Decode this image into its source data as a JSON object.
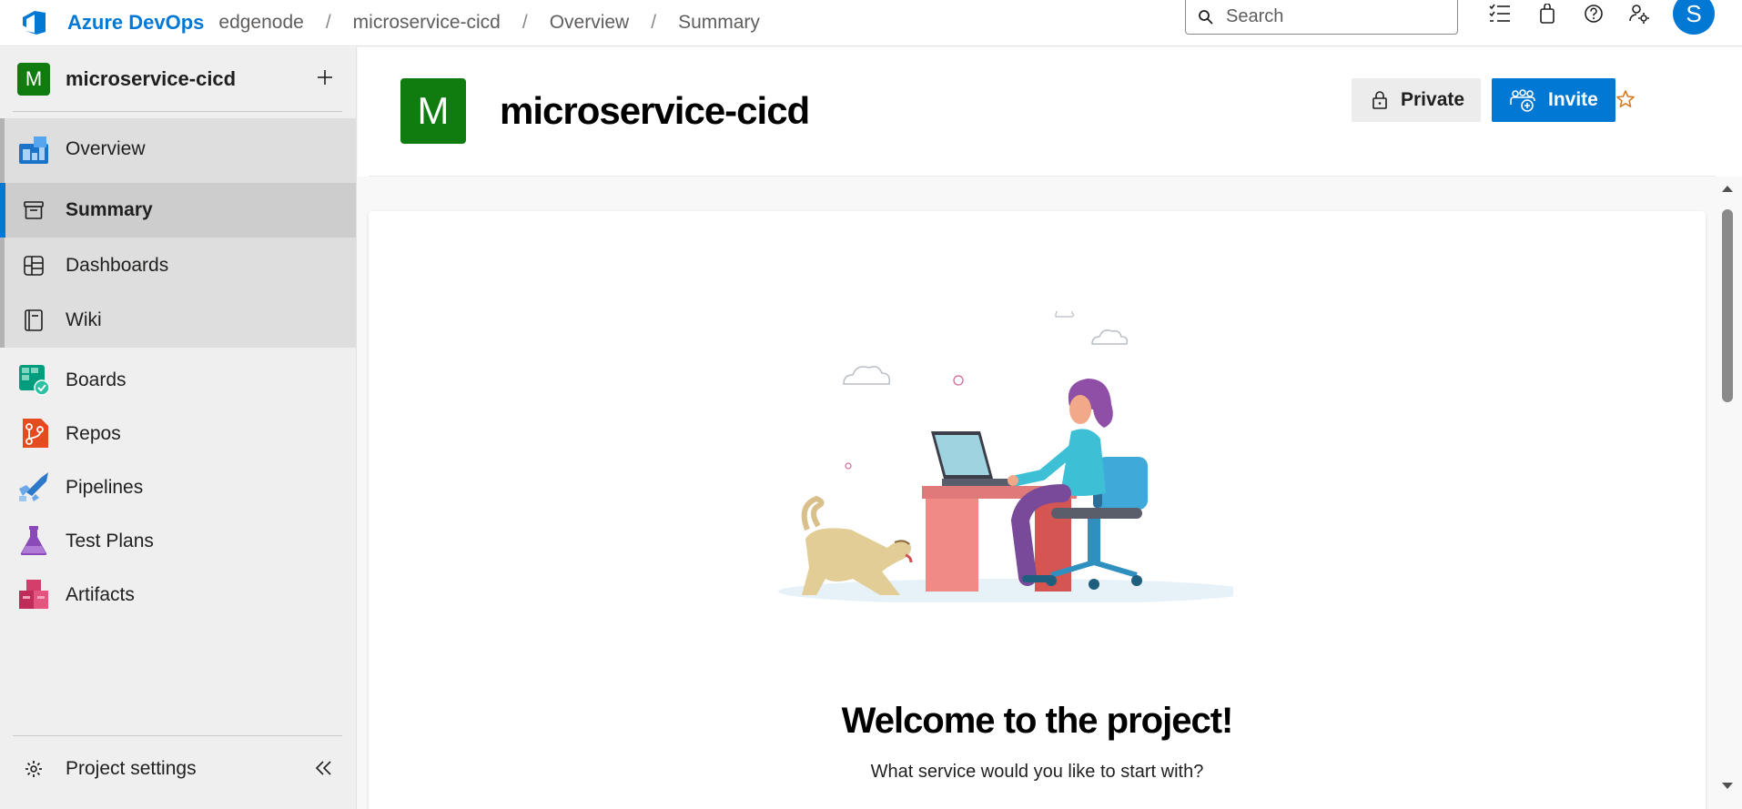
{
  "topbar": {
    "brand": "Azure DevOps",
    "breadcrumb": [
      "edgenode",
      "microservice-cicd",
      "Overview",
      "Summary"
    ],
    "separator": "/",
    "search_placeholder": "Search",
    "avatar_initial": "S",
    "icons": [
      "task-list-icon",
      "shopping-bag-icon",
      "help-icon",
      "user-settings-icon"
    ]
  },
  "sidebar": {
    "project_initial": "M",
    "project_name": "microservice-cicd",
    "items": [
      {
        "label": "Overview",
        "icon": "overview-icon"
      },
      {
        "label": "Summary",
        "icon": "summary-icon"
      },
      {
        "label": "Dashboards",
        "icon": "dashboards-icon"
      },
      {
        "label": "Wiki",
        "icon": "wiki-icon"
      },
      {
        "label": "Boards",
        "icon": "boards-icon"
      },
      {
        "label": "Repos",
        "icon": "repos-icon"
      },
      {
        "label": "Pipelines",
        "icon": "pipelines-icon"
      },
      {
        "label": "Test Plans",
        "icon": "test-plans-icon"
      },
      {
        "label": "Artifacts",
        "icon": "artifacts-icon"
      }
    ],
    "settings_label": "Project settings"
  },
  "main": {
    "project_initial": "M",
    "title": "microservice-cicd",
    "private_label": "Private",
    "invite_label": "Invite",
    "welcome_title": "Welcome to the project!",
    "welcome_subtitle": "What service would you like to start with?"
  },
  "colors": {
    "accent": "#0078d4",
    "project_tile": "#107c10",
    "star": "#d67b24"
  }
}
